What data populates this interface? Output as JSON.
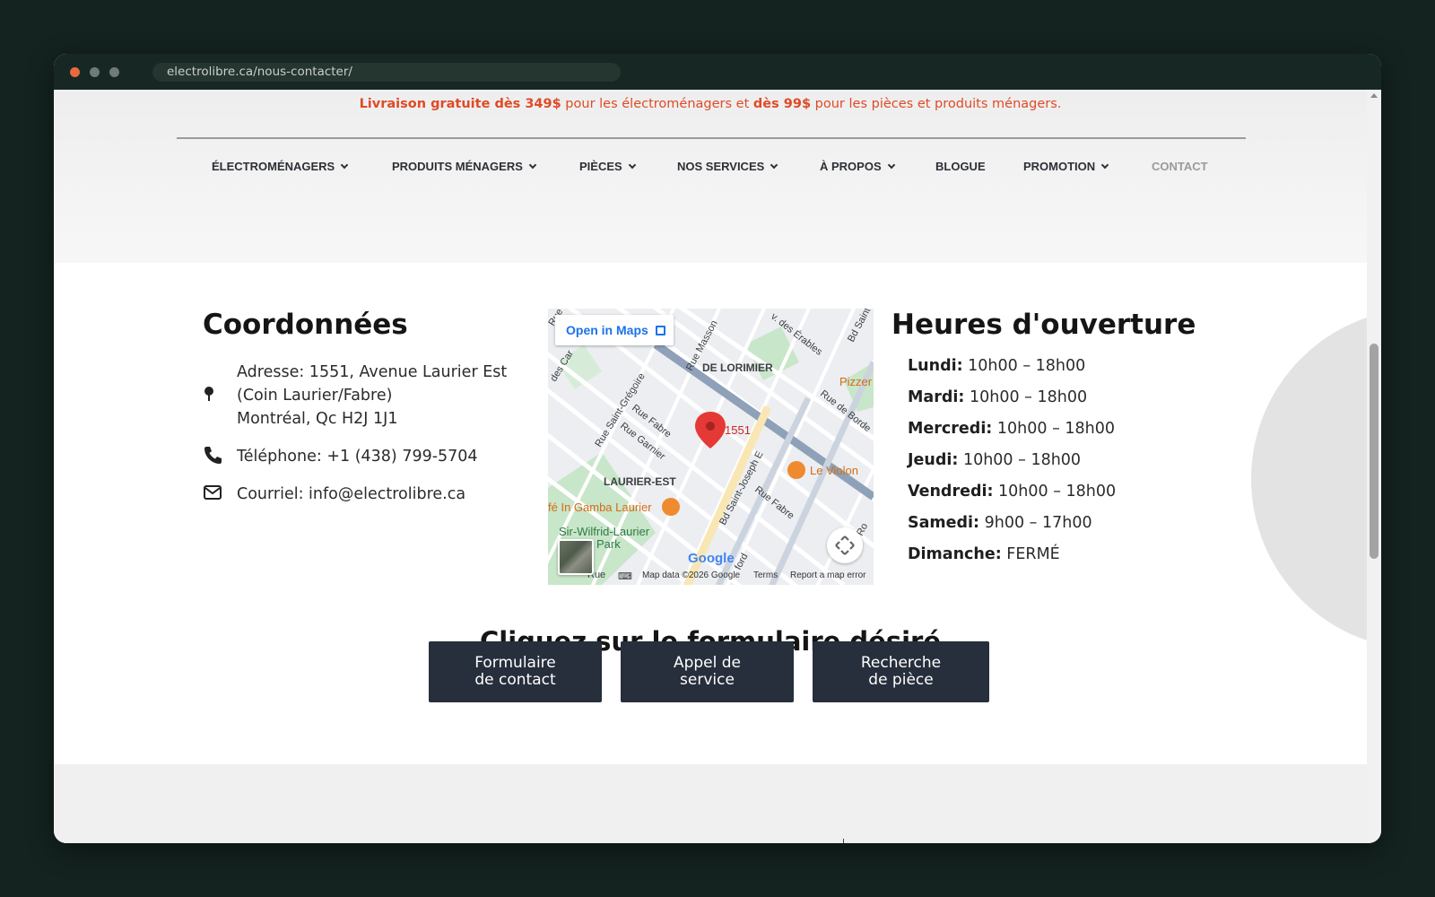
{
  "browser": {
    "url": "electrolibre.ca/nous-contacter/"
  },
  "promo": {
    "bold1": "Livraison gratuite dès 349$",
    "text1": " pour les électroménagers et ",
    "bold2": "dès 99$",
    "text2": " pour les pièces et produits ménagers."
  },
  "nav": [
    {
      "label": "ÉLECTROMÉNAGERS"
    },
    {
      "label": "PRODUITS MÉNAGERS"
    },
    {
      "label": "PIÈCES"
    },
    {
      "label": "NOS SERVICES"
    },
    {
      "label": "À PROPOS"
    },
    {
      "label": "BLOGUE"
    },
    {
      "label": "PROMOTION"
    },
    {
      "label": "CONTACT"
    }
  ],
  "contact": {
    "title": "Coordonnées",
    "address_line1": "Adresse: 1551, Avenue Laurier Est",
    "address_line2": "(Coin Laurier/Fabre)",
    "address_line3": "Montréal, Qc H2J 1J1",
    "phone": "Téléphone: +1 (438) 799-5704",
    "email": "Courriel: info@electrolibre.ca"
  },
  "map": {
    "open_label": "Open in Maps",
    "marker_label": "1551",
    "labels": {
      "de_lorimier": "DE LORIMIER",
      "laurier_est": "LAURIER-EST",
      "rue_masson": "Rue Masson",
      "rue_st_gregoire": "Rue Saint-Grégoire",
      "rue_fabre": "Rue Fabre",
      "rue_garnier": "Rue Garnier",
      "bd_st_joseph": "Bd Saint-Joseph E",
      "rue_fabre_2": "Rue Fabre",
      "rue_de_bordeaux": "Rue de Borde",
      "des_erables": "v. des Érables",
      "bd_saint": "Bd Saint",
      "le_violon": "Le Violon",
      "pizzeria": "Pizzer",
      "in_gamba": "fé In Gamba Laurier",
      "park": "Sir-Wilfrid-Laurier Park",
      "park_line1": "Sir-Wilfrid-Laurier",
      "park_line2": "Park",
      "des_car": "des Car",
      "rue_left": "Rue",
      "ford": "ford",
      "rue_ro": "Ro",
      "rue_bottom": "Rue"
    },
    "google": "Google",
    "footer": {
      "data": "Map data ©2026 Google",
      "terms": "Terms",
      "report": "Report a map error"
    }
  },
  "hours": {
    "title": "Heures d'ouverture",
    "days": [
      {
        "day": "Lundi:",
        "time": " 10h00 – 18h00"
      },
      {
        "day": "Mardi:",
        "time": " 10h00 – 18h00"
      },
      {
        "day": "Mercredi:",
        "time": " 10h00 – 18h00"
      },
      {
        "day": "Jeudi:",
        "time": " 10h00 – 18h00"
      },
      {
        "day": "Vendredi:",
        "time": " 10h00 – 18h00"
      },
      {
        "day": "Samedi:",
        "time": " 9h00 – 17h00"
      },
      {
        "day": "Dimanche:",
        "time": " FERMÉ"
      }
    ]
  },
  "forms": {
    "title": "Cliquez sur le formulaire désiré",
    "buttons": [
      {
        "line1": "Formulaire",
        "line2": "de contact"
      },
      {
        "line1": "Appel de",
        "line2": "service"
      },
      {
        "line1": "Recherche",
        "line2": "de pièce"
      }
    ]
  },
  "colors": {
    "accent": "#e04a26",
    "button_bg": "#272e3c",
    "browser_frame": "#172724"
  }
}
